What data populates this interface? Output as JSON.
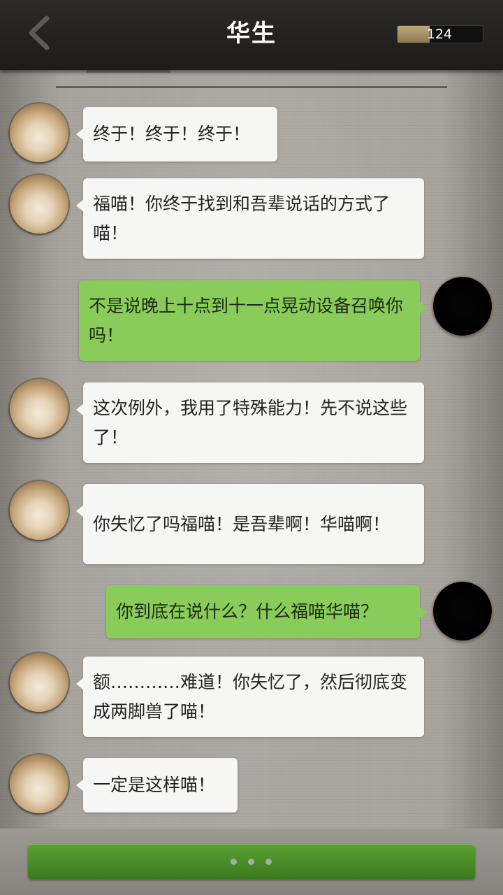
{
  "header": {
    "title": "华生",
    "back_icon": "chevron-left-icon",
    "counter_value": "124",
    "counter_fill_fraction": 0.38,
    "counter_fill_color": "#b09a6d"
  },
  "messages": [
    {
      "side": "left",
      "avatar": "cat-avatar",
      "text": "终于！终于！终于！"
    },
    {
      "side": "left",
      "avatar": "cat-avatar",
      "text": "福喵！你终于找到和吾辈说话的方式了喵！"
    },
    {
      "side": "right",
      "avatar": "user-avatar",
      "text": "不是说晚上十点到十一点晃动设备召唤你吗！"
    },
    {
      "side": "left",
      "avatar": "cat-avatar",
      "text": "这次例外，我用了特殊能力！先不说这些了！"
    },
    {
      "side": "left",
      "avatar": "cat-avatar",
      "text": "你失忆了吗福喵！是吾辈啊！华喵啊！"
    },
    {
      "side": "right",
      "avatar": "user-avatar",
      "text": "你到底在说什么？什么福喵华喵？"
    },
    {
      "side": "left",
      "avatar": "cat-avatar",
      "text": "额…………难道！你失忆了，然后彻底变成两脚兽了喵！"
    },
    {
      "side": "left",
      "avatar": "cat-avatar",
      "text": "一定是这样喵！"
    }
  ],
  "footer": {
    "button_state": "typing",
    "dots_icon": "typing-dots-icon"
  },
  "colors": {
    "left_bubble": "#f6f6f4",
    "right_bubble": "#8acc59",
    "action_button": "#4a8d28",
    "header_bg": "#232220"
  }
}
